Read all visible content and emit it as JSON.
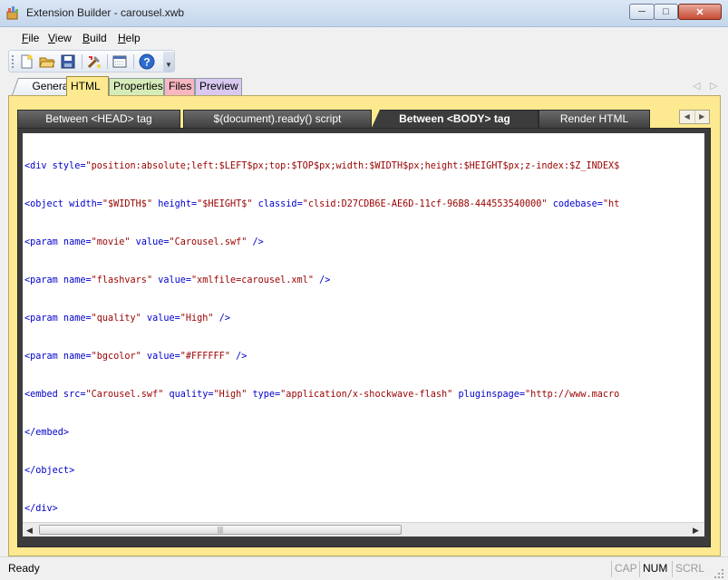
{
  "window": {
    "title": "Extension Builder - carousel.xwb",
    "icon": "app-tools-icon"
  },
  "menu": {
    "items": [
      {
        "label": "File",
        "mnemonic": "F",
        "rest": "ile"
      },
      {
        "label": "View",
        "mnemonic": "V",
        "rest": "iew"
      },
      {
        "label": "Build",
        "mnemonic": "B",
        "rest": "uild"
      },
      {
        "label": "Help",
        "mnemonic": "H",
        "rest": "elp"
      }
    ]
  },
  "toolbar": {
    "icons": [
      "new-file-icon",
      "open-folder-icon",
      "save-icon",
      "build-tools-icon",
      "preview-window-icon",
      "help-icon",
      "toolbar-options-icon"
    ]
  },
  "main_tabs": {
    "general": "General",
    "html": "HTML",
    "properties": "Properties",
    "files": "Files",
    "preview": "Preview",
    "active": "HTML"
  },
  "html_tabs": {
    "head": "Between <HEAD> tag",
    "ready": "$(document).ready() script",
    "body": "Between <BODY> tag",
    "render": "Render HTML",
    "active": "Between <BODY> tag"
  },
  "editor": {
    "lines": [
      "<div style=\"position:absolute;left:$LEFT$px;top:$TOP$px;width:$WIDTH$px;height:$HEIGHT$px;z-index:$Z_INDEX$",
      "<object width=\"$WIDTH$\" height=\"$HEIGHT$\" classid=\"clsid:D27CDB6E-AE6D-11cf-96B8-444553540000\" codebase=\"ht",
      "<param name=\"movie\" value=\"Carousel.swf\" />",
      "<param name=\"flashvars\" value=\"xmlfile=carousel.xml\" />",
      "<param name=\"quality\" value=\"High\" />",
      "<param name=\"bgcolor\" value=\"#FFFFFF\" />",
      "<embed src=\"Carousel.swf\" quality=\"High\" type=\"application/x-shockwave-flash\" pluginspage=\"http://www.macro",
      "</embed>",
      "</object>",
      "</div>"
    ]
  },
  "status": {
    "text": "Ready",
    "cap": "CAP",
    "num": "NUM",
    "scrl": "SCRL"
  },
  "colors": {
    "html_panel": "#fde98f",
    "properties_tab": "#d6ecb8",
    "files_tab": "#f7b6c0",
    "preview_tab": "#d9c8ef",
    "code_text": "#0000cc",
    "code_string": "#990000"
  }
}
